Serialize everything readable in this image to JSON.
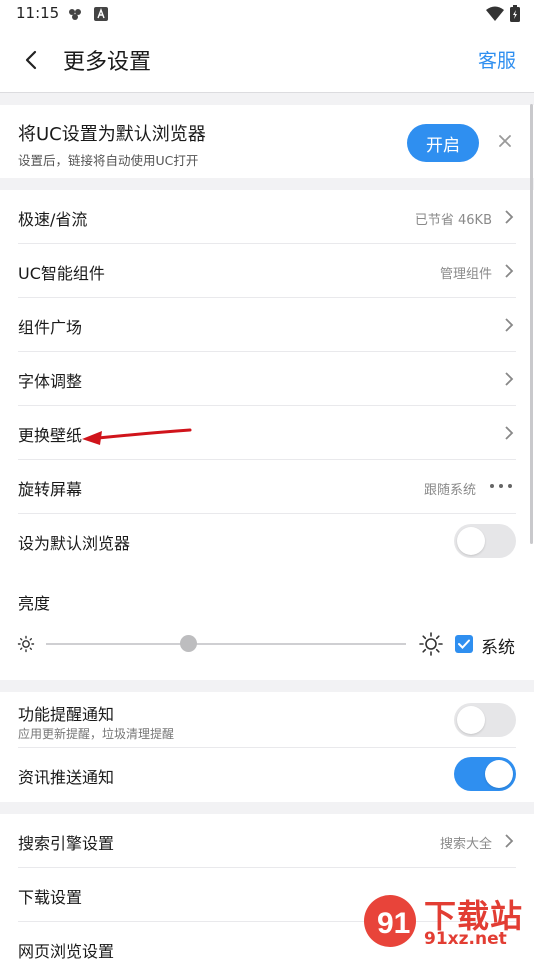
{
  "status_bar": {
    "time": "11:15"
  },
  "header": {
    "title": "更多设置",
    "service": "客服"
  },
  "banner": {
    "title": "将UC设置为默认浏览器",
    "subtitle": "设置后，链接将自动使用UC打开",
    "open_label": "开启"
  },
  "rows": {
    "speed": {
      "label": "极速/省流",
      "value": "已节省 46KB"
    },
    "widget": {
      "label": "UC智能组件",
      "value": "管理组件"
    },
    "widget_square": {
      "label": "组件广场"
    },
    "font": {
      "label": "字体调整"
    },
    "wallpaper": {
      "label": "更换壁纸"
    },
    "rotate": {
      "label": "旋转屏幕",
      "value": "跟随系统"
    },
    "default_browser": {
      "label": "设为默认浏览器",
      "toggle": "off"
    },
    "brightness": {
      "label": "亮度",
      "level_fraction": 0.4,
      "system_checked": true,
      "system_label": "系统"
    },
    "feature_notify": {
      "label": "功能提醒通知",
      "sub": "应用更新提醒，垃圾清理提醒",
      "toggle": "off"
    },
    "news_notify": {
      "label": "资讯推送通知",
      "toggle": "on"
    },
    "search_engine": {
      "label": "搜索引擎设置",
      "value": "搜索大全"
    },
    "download": {
      "label": "下载设置"
    },
    "web_browse": {
      "label": "网页浏览设置"
    }
  },
  "watermark": {
    "brand": "下载站",
    "domain": "91xz.net"
  },
  "colors": {
    "accent": "#2f8ff0",
    "band": "#f2f2f4",
    "annotation_arrow": "#d0141b"
  }
}
